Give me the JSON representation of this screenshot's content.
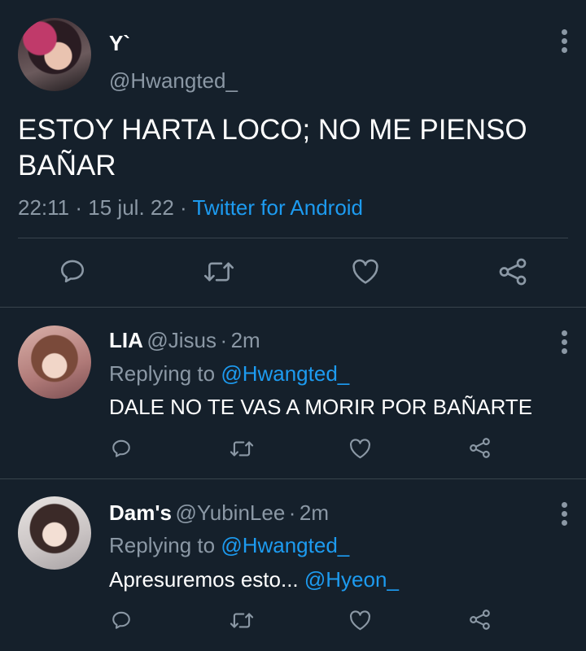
{
  "main_tweet": {
    "display_name": "Y`",
    "handle": "@Hwangted_",
    "text": "ESTOY HARTA LOCO; NO ME PIENSO BAÑAR",
    "time": "22:11",
    "date": "15 jul. 22",
    "source": "Twitter for Android",
    "separator": "·"
  },
  "replies": [
    {
      "display_name": "LIA",
      "handle": "@Jisus",
      "age": "2m",
      "replying_prefix": "Replying to",
      "replying_handle": "@Hwangted_",
      "text": "DALE NO TE VAS A MORIR POR BAÑARTE",
      "mention": ""
    },
    {
      "display_name": "Dam's",
      "handle": "@YubinLee",
      "age": "2m",
      "replying_prefix": "Replying to",
      "replying_handle": "@Hwangted_",
      "text": "Apresuremos esto...",
      "mention": "@Hyeon_"
    }
  ],
  "colors": {
    "background": "#15202b",
    "text": "#ffffff",
    "muted": "#8b98a5",
    "link": "#1d9bf0",
    "divider": "#38444d"
  },
  "icons": [
    "reply-icon",
    "retweet-icon",
    "like-icon",
    "share-icon",
    "more-options-icon"
  ]
}
